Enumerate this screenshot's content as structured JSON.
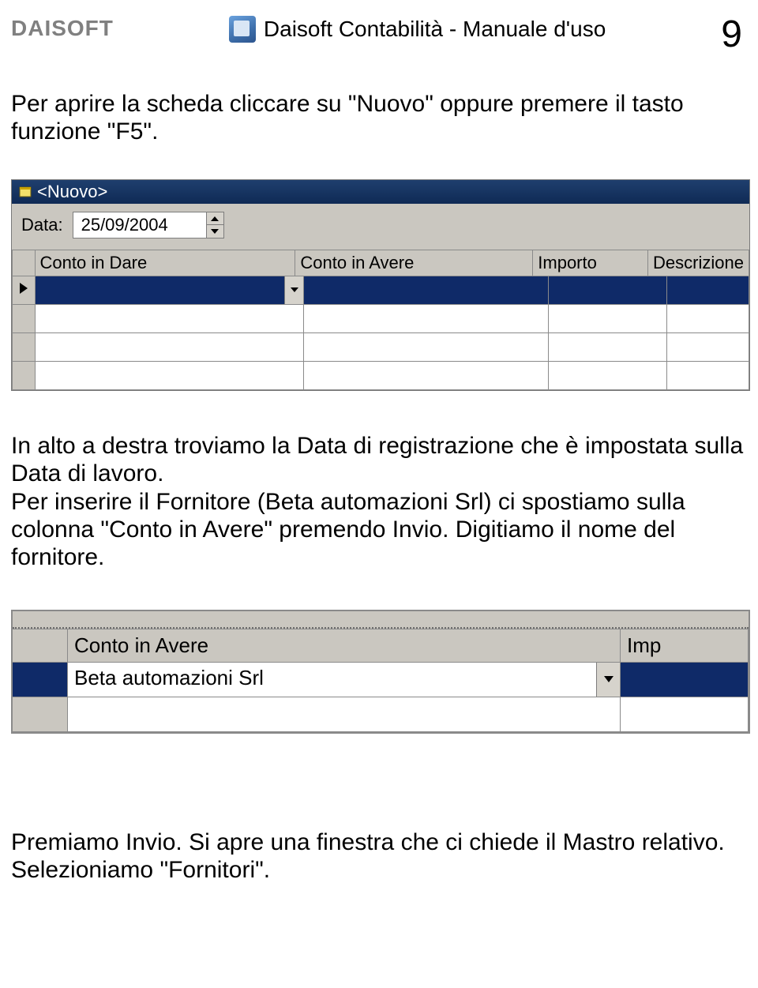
{
  "header": {
    "brand": "DAISOFT",
    "doc_title": "Daisoft Contabilità - Manuale d'uso",
    "page_number": "9"
  },
  "para1": "Per aprire la scheda cliccare su \"Nuovo\" oppure premere il tasto funzione \"F5\".",
  "window": {
    "title": "<Nuovo>",
    "date_label": "Data:",
    "date_value": "25/09/2004",
    "columns": {
      "dare": "Conto in Dare",
      "avere": "Conto in Avere",
      "importo": "Importo",
      "descrizione": "Descrizione"
    }
  },
  "para2": "In alto a destra troviamo la Data di registrazione che è impostata sulla Data di lavoro.\nPer inserire il Fornitore (Beta automazioni Srl) ci spostiamo sulla colonna \"Conto in Avere\" premendo Invio. Digitiamo il nome del fornitore.",
  "fragment": {
    "columns": {
      "avere": "Conto in Avere",
      "imp": "Imp"
    },
    "value": "Beta automazioni Srl"
  },
  "para3": "Premiamo Invio. Si apre una finestra che ci chiede il Mastro relativo. Selezioniamo \"Fornitori\"."
}
